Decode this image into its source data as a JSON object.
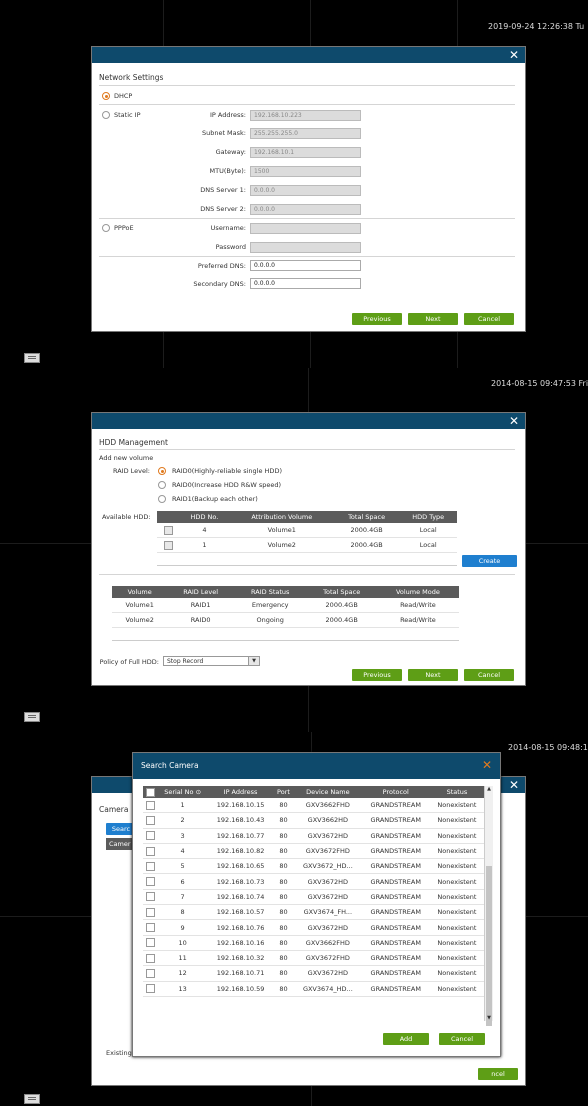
{
  "panel1": {
    "timestamp": "2019-09-24 12:26:38 Tu",
    "title": "Network Settings",
    "dhcp_label": "DHCP",
    "static_label": "Static IP",
    "ip_label": "IP Address:",
    "ip_value": "192.168.10.223",
    "subnet_label": "Subnet Mask:",
    "subnet_value": "255.255.255.0",
    "gateway_label": "Gateway:",
    "gateway_value": "192.168.10.1",
    "mtu_label": "MTU(Byte):",
    "mtu_value": "1500",
    "dns1_label": "DNS Server 1:",
    "dns1_value": "0.0.0.0",
    "dns2_label": "DNS Server 2:",
    "dns2_value": "0.0.0.0",
    "pppoe_label": "PPPoE",
    "username_label": "Username:",
    "password_label": "Password",
    "pref_dns_label": "Preferred DNS:",
    "pref_dns_value": "0.0.0.0",
    "sec_dns_label": "Secondary DNS:",
    "sec_dns_value": "0.0.0.0",
    "btn_previous": "Previous",
    "btn_next": "Next",
    "btn_cancel": "Cancel",
    "close": "✕"
  },
  "panel2": {
    "timestamp": "2014-08-15 09:47:53 Fri",
    "title": "HDD Management",
    "add_volume": "Add new volume",
    "raid_level_label": "RAID Level:",
    "raid_options": [
      "RAID0(Highly-reliable single HDD)",
      "RAID0(Increase HDD R&W speed)",
      "RAID1(Backup each other)"
    ],
    "available_label": "Available HDD:",
    "hdd_headers": [
      "HDD No.",
      "Attribution Volume",
      "Total Space",
      "HDD Type"
    ],
    "hdd_rows": [
      [
        "4",
        "Volume1",
        "2000.4GB",
        "Local"
      ],
      [
        "1",
        "Volume2",
        "2000.4GB",
        "Local"
      ]
    ],
    "create": "Create",
    "vol_headers": [
      "Volume",
      "RAID Level",
      "RAID Status",
      "Total Space",
      "Volume Mode"
    ],
    "vol_rows": [
      [
        "Volume1",
        "RAID1",
        "Emergency",
        "2000.4GB",
        "Read/Write"
      ],
      [
        "Volume2",
        "RAID0",
        "Ongoing",
        "2000.4GB",
        "Read/Write"
      ]
    ],
    "policy_label": "Policy of Full HDD:",
    "policy_value": "Stop Record",
    "btn_previous": "Previous",
    "btn_next": "Next",
    "btn_cancel": "Cancel",
    "close": "✕"
  },
  "panel3": {
    "timestamp": "2014-08-15 09:48:1",
    "bg_title": "Camera",
    "bg_search": "Searc",
    "bg_camera": "Camer",
    "bg_existing": "Existing",
    "bg_cancel": "ncel",
    "bg_close": "✕",
    "search_title": "Search Camera",
    "search_close": "✕",
    "headers": [
      "Serial No",
      "IP Address",
      "Port",
      "Device Name",
      "Protocol",
      "Status"
    ],
    "rows": [
      [
        "1",
        "192.168.10.15",
        "80",
        "GXV3662FHD",
        "GRANDSTREAM",
        "Nonexistent"
      ],
      [
        "2",
        "192.168.10.43",
        "80",
        "GXV3662HD",
        "GRANDSTREAM",
        "Nonexistent"
      ],
      [
        "3",
        "192.168.10.77",
        "80",
        "GXV3672HD",
        "GRANDSTREAM",
        "Nonexistent"
      ],
      [
        "4",
        "192.168.10.82",
        "80",
        "GXV3672FHD",
        "GRANDSTREAM",
        "Nonexistent"
      ],
      [
        "5",
        "192.168.10.65",
        "80",
        "GXV3672_HD...",
        "GRANDSTREAM",
        "Nonexistent"
      ],
      [
        "6",
        "192.168.10.73",
        "80",
        "GXV3672HD",
        "GRANDSTREAM",
        "Nonexistent"
      ],
      [
        "7",
        "192.168.10.74",
        "80",
        "GXV3672HD",
        "GRANDSTREAM",
        "Nonexistent"
      ],
      [
        "8",
        "192.168.10.57",
        "80",
        "GXV3674_FH...",
        "GRANDSTREAM",
        "Nonexistent"
      ],
      [
        "9",
        "192.168.10.76",
        "80",
        "GXV3672HD",
        "GRANDSTREAM",
        "Nonexistent"
      ],
      [
        "10",
        "192.168.10.16",
        "80",
        "GXV3662FHD",
        "GRANDSTREAM",
        "Nonexistent"
      ],
      [
        "11",
        "192.168.10.32",
        "80",
        "GXV3672FHD",
        "GRANDSTREAM",
        "Nonexistent"
      ],
      [
        "12",
        "192.168.10.71",
        "80",
        "GXV3672HD",
        "GRANDSTREAM",
        "Nonexistent"
      ],
      [
        "13",
        "192.168.10.59",
        "80",
        "GXV3674_HD...",
        "GRANDSTREAM",
        "Nonexistent"
      ]
    ],
    "btn_add": "Add",
    "btn_cancel": "Cancel"
  }
}
